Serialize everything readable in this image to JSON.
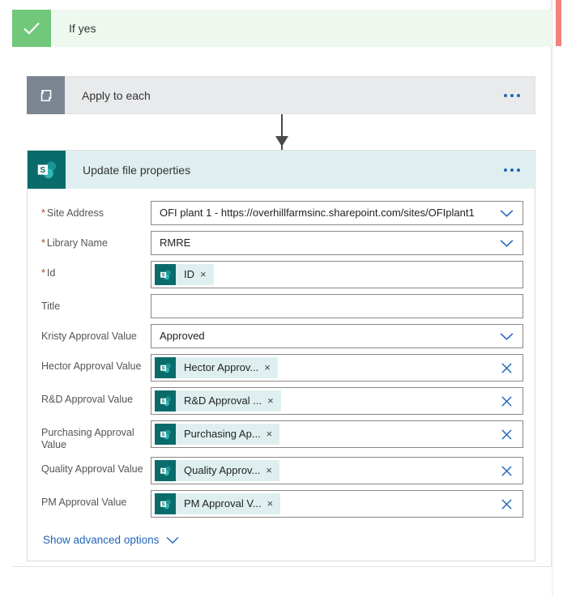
{
  "branch": {
    "yes_label": "If yes",
    "yes_icon": "checkmark-icon",
    "yes_accent": "#72c87a",
    "yes_header_bg": "#eef8ef",
    "no_accent": "#f1827d"
  },
  "loop_card": {
    "title": "Apply to each",
    "icon": "loop-icon",
    "icon_bg": "#7a8591",
    "header_bg": "#e8eaec",
    "overflow_label": "more-options"
  },
  "action_card": {
    "title": "Update file properties",
    "icon": "sharepoint-icon",
    "icon_bg": "#0a6b6b",
    "header_bg": "#dfeff0",
    "overflow_label": "more-options",
    "advanced_link": "Show advanced options",
    "advanced_chevron": "chevron-down-icon"
  },
  "fields": [
    {
      "label": "Site Address",
      "required": true,
      "kind": "dropdown",
      "value": "OFI plant 1 - https://overhillfarmsinc.sharepoint.com/sites/OFIplant1",
      "control_icon": "chevron-down-icon"
    },
    {
      "label": "Library Name",
      "required": true,
      "kind": "dropdown",
      "value": "RMRE",
      "control_icon": "chevron-down-icon"
    },
    {
      "label": "Id",
      "required": true,
      "kind": "token",
      "token": {
        "text": "ID",
        "icon": "sharepoint-icon",
        "remove_icon": "close-icon"
      },
      "control_icon": ""
    },
    {
      "label": "Title",
      "required": false,
      "kind": "text",
      "value": "",
      "placeholder": "",
      "control_icon": ""
    },
    {
      "label": "Kristy Approval Value",
      "required": false,
      "kind": "dropdown",
      "value": "Approved",
      "control_icon": "chevron-down-icon"
    },
    {
      "label": "Hector Approval Value",
      "required": false,
      "kind": "token",
      "token": {
        "text": "Hector Approv...",
        "icon": "sharepoint-icon",
        "remove_icon": "close-icon"
      },
      "control_icon": "close-icon"
    },
    {
      "label": "R&D Approval Value",
      "required": false,
      "kind": "token",
      "token": {
        "text": "R&D Approval ...",
        "icon": "sharepoint-icon",
        "remove_icon": "close-icon"
      },
      "control_icon": "close-icon"
    },
    {
      "label": "Purchasing Approval Value",
      "required": false,
      "kind": "token",
      "token": {
        "text": "Purchasing Ap...",
        "icon": "sharepoint-icon",
        "remove_icon": "close-icon"
      },
      "control_icon": "close-icon"
    },
    {
      "label": "Quality Approval Value",
      "required": false,
      "kind": "token",
      "token": {
        "text": "Quality Approv...",
        "icon": "sharepoint-icon",
        "remove_icon": "close-icon"
      },
      "control_icon": "close-icon"
    },
    {
      "label": "PM Approval Value",
      "required": false,
      "kind": "token",
      "token": {
        "text": "PM Approval V...",
        "icon": "sharepoint-icon",
        "remove_icon": "close-icon"
      },
      "control_icon": "close-icon"
    }
  ]
}
